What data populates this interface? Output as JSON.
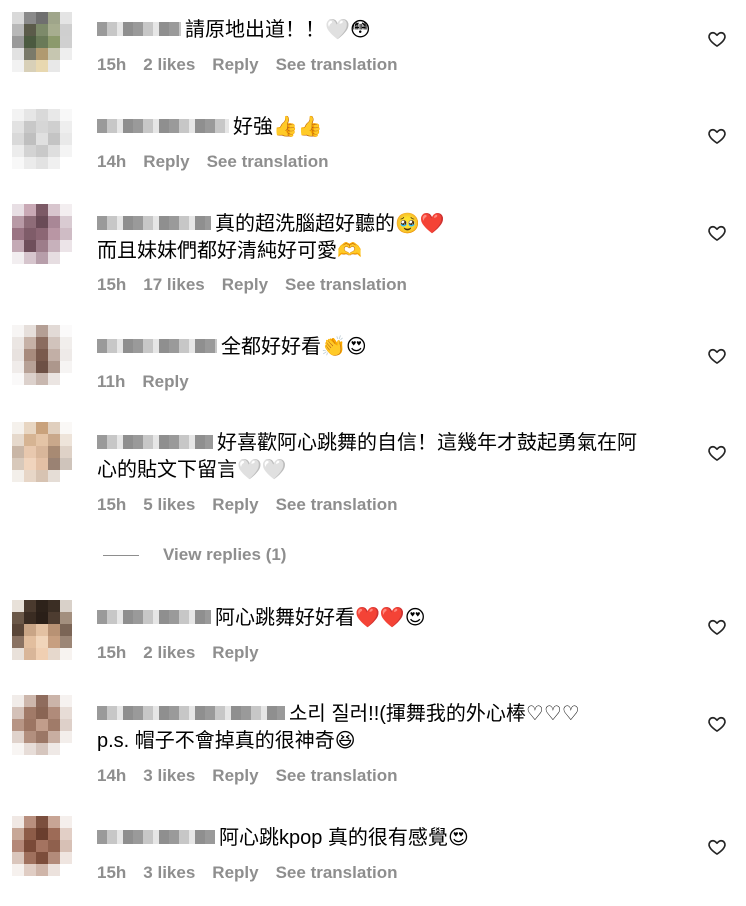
{
  "comments": [
    {
      "text": "請原地出道！！",
      "emoji": "🤍😳",
      "time": "15h",
      "likes": "2 likes",
      "reply": "Reply",
      "translate": "See translation"
    },
    {
      "text": "好強",
      "emoji": "👍👍",
      "time": "14h",
      "likes": "",
      "reply": "Reply",
      "translate": "See translation"
    },
    {
      "text": "真的超洗腦超好聽的",
      "emoji": "🥹❤️",
      "text2": "而且妹妹們都好清純好可愛",
      "emoji2": "🫶",
      "time": "15h",
      "likes": "17 likes",
      "reply": "Reply",
      "translate": "See translation"
    },
    {
      "text": "全都好好看",
      "emoji": "👏😍",
      "time": "11h",
      "likes": "",
      "reply": "Reply",
      "translate": ""
    },
    {
      "text": "好喜歡阿心跳舞的自信！這幾年才鼓起勇氣在阿",
      "text2": "心的貼文下留言",
      "emoji2": "🤍🤍",
      "time": "15h",
      "likes": "5 likes",
      "reply": "Reply",
      "translate": "See translation"
    },
    {
      "text": "阿心跳舞好好看",
      "emoji": "❤️❤️😍",
      "time": "15h",
      "likes": "2 likes",
      "reply": "Reply",
      "translate": ""
    },
    {
      "text": "소리 질러!!(揮舞我的外心棒♡♡♡",
      "text2": "p.s. 帽子不會掉真的很神奇",
      "emoji2": "😆",
      "time": "14h",
      "likes": "3 likes",
      "reply": "Reply",
      "translate": "See translation"
    },
    {
      "text": "阿心跳kpop 真的很有感覺",
      "emoji": "😍",
      "time": "15h",
      "likes": "3 likes",
      "reply": "Reply",
      "translate": "See translation"
    }
  ],
  "view_replies": "View replies (1)",
  "icons": {
    "like": "heart-outline-icon"
  },
  "colors": {
    "meta": "#8e8e8e"
  }
}
